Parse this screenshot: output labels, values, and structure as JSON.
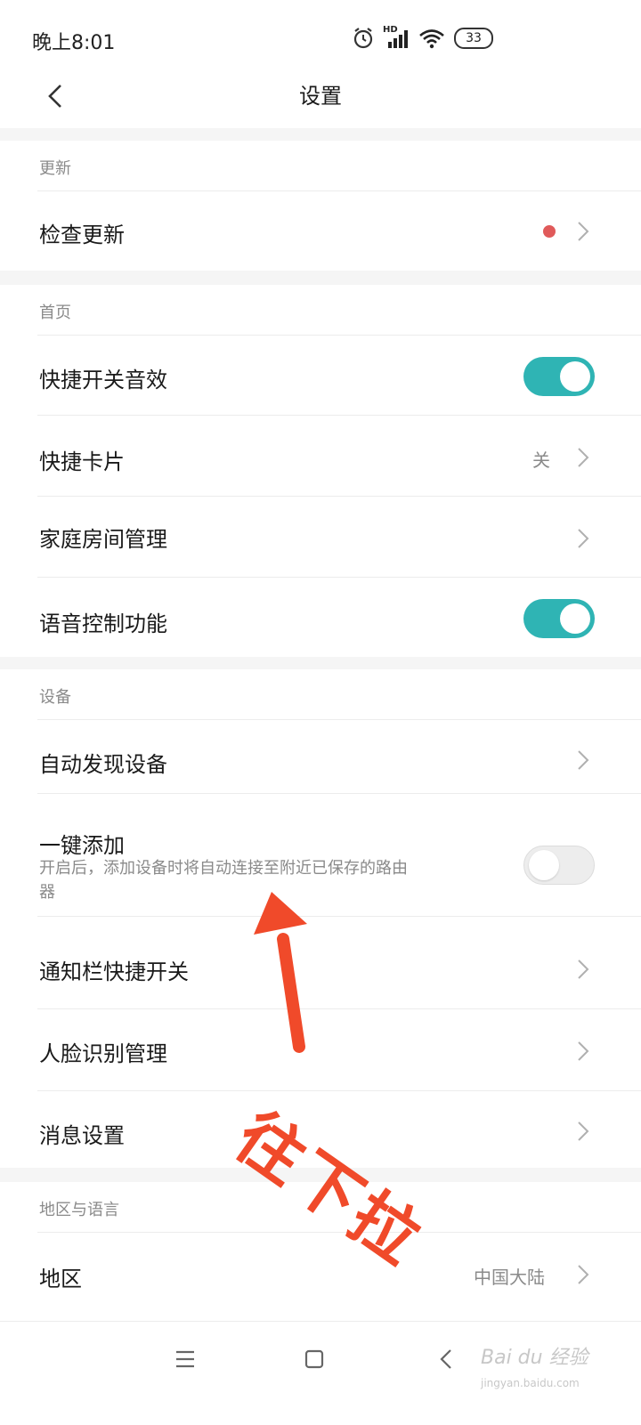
{
  "status_bar": {
    "time": "晚上8:01",
    "network_label": "HD",
    "battery": "33",
    "icons": [
      "alarm-icon",
      "signal-icon",
      "wifi-icon",
      "battery-icon"
    ]
  },
  "header": {
    "title": "设置",
    "back_icon": "chevron-left-icon"
  },
  "sections": {
    "update": {
      "title": "更新",
      "check_update": {
        "label": "检查更新",
        "has_notification": true
      }
    },
    "home": {
      "title": "首页",
      "quick_switch_sound": {
        "label": "快捷开关音效",
        "enabled": true
      },
      "quick_card": {
        "label": "快捷卡片",
        "value": "关"
      },
      "home_room": {
        "label": "家庭房间管理"
      },
      "voice_control": {
        "label": "语音控制功能",
        "enabled": true
      }
    },
    "device": {
      "title": "设备",
      "auto_discover": {
        "label": "自动发现设备"
      },
      "one_key_add": {
        "label": "一键添加",
        "description": "开启后，添加设备时将自动连接至附近已保存的路由器",
        "enabled": false
      },
      "notification_shortcut": {
        "label": "通知栏快捷开关"
      },
      "face_recognition": {
        "label": "人脸识别管理"
      },
      "message_settings": {
        "label": "消息设置"
      }
    },
    "region_language": {
      "title": "地区与语言",
      "region": {
        "label": "地区",
        "value": "中国大陆"
      }
    }
  },
  "annotation": {
    "text": "往下拉",
    "color": "#f04a2a"
  },
  "nav_bar": {
    "icons": [
      "menu-icon",
      "home-icon",
      "back-icon"
    ]
  },
  "watermark": {
    "brand": "Bai du 经验",
    "url": "jingyan.baidu.com"
  },
  "colors": {
    "accent": "#2fb4b4",
    "notification_dot": "#e05a5a",
    "background": "#f5f5f5"
  }
}
